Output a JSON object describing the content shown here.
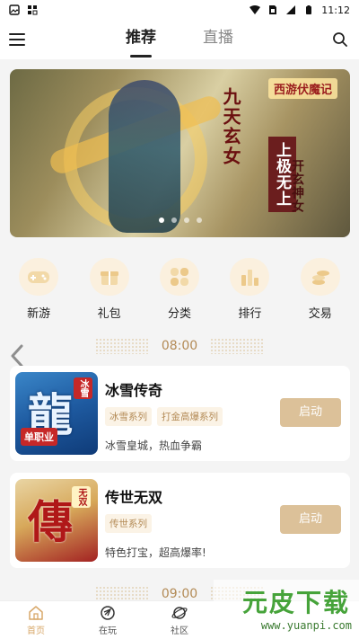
{
  "status": {
    "time": "11:12"
  },
  "header": {
    "tabs": [
      {
        "label": "推荐",
        "active": true
      },
      {
        "label": "直播",
        "active": false
      }
    ]
  },
  "banner": {
    "brand": "西游伏魔记",
    "line1": "九天玄女",
    "line2": "上极无上",
    "line3": "开玄神女",
    "pages": 4,
    "active_page": 0
  },
  "categories": [
    {
      "label": "新游",
      "icon": "gamepad-icon"
    },
    {
      "label": "礼包",
      "icon": "gift-icon"
    },
    {
      "label": "分类",
      "icon": "grid-icon"
    },
    {
      "label": "排行",
      "icon": "bar-chart-icon"
    },
    {
      "label": "交易",
      "icon": "coins-icon"
    }
  ],
  "sections": [
    {
      "time": "08:00",
      "game": {
        "title": "冰雪传奇",
        "tags": [
          "冰雪系列",
          "打金高爆系列"
        ],
        "desc": "冰雪皇城，热血争霸",
        "button": "启动",
        "thumb_char": "龍",
        "thumb_tag1": "冰雪",
        "thumb_tag2": "单职业"
      }
    },
    {
      "time": "09:00",
      "game": {
        "title": "传世无双",
        "tags": [
          "传世系列"
        ],
        "desc": "特色打宝，超高爆率!",
        "button": "启动",
        "thumb_char": "傳",
        "thumb_tag1": "无双"
      }
    }
  ],
  "bottom_nav": [
    {
      "label": "首页",
      "active": true
    },
    {
      "label": "在玩",
      "active": false
    },
    {
      "label": "社区",
      "active": false
    },
    {
      "label": "",
      "active": false
    },
    {
      "label": "",
      "active": false
    }
  ],
  "watermark": {
    "title": "元皮下载",
    "url": "www.yuanpi.com"
  },
  "colors": {
    "accent": "#b38a55",
    "button": "#dcc199",
    "active_nav": "#d8a86a"
  }
}
